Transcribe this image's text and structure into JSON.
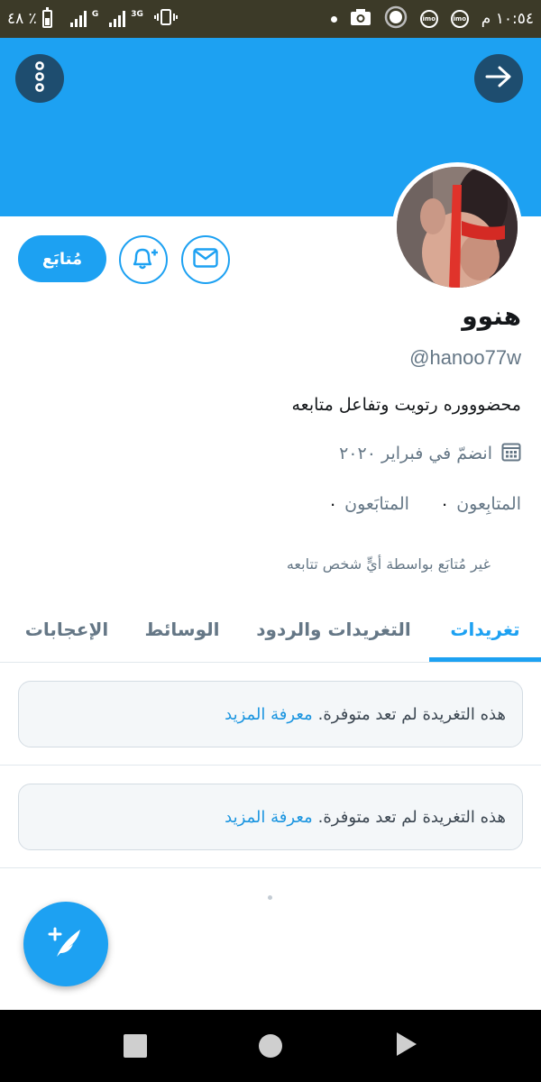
{
  "status_bar": {
    "battery": "٤٨ ٪",
    "network_g": "G",
    "network_3g": "3G",
    "imo1": "imo",
    "imo2": "imo",
    "time": "١٠:٥٤ م"
  },
  "header": {
    "back_icon": "arrow-right-icon",
    "menu_icon": "more-vertical-icon",
    "banner_color": "#1da1f2"
  },
  "actions": {
    "follow_label": "مُتابَع",
    "notify_icon": "bell-plus-icon",
    "message_icon": "envelope-icon"
  },
  "profile": {
    "display_name": "هنوو",
    "handle": "@hanoo77w",
    "bio": "محضوووره رتويت وتفاعل متابعه",
    "joined": "انضمّ في فبراير ٢٠٢٠",
    "following_count": "٠",
    "following_label": "المتابَعون",
    "followers_count": "٠",
    "followers_label": "المتابِعون",
    "not_followed_text": "غير مُتابَع بواسطة أيٍّ شخص تتابعه"
  },
  "tabs": [
    {
      "label": "تغريدات",
      "active": true
    },
    {
      "label": "التغريدات والردود",
      "active": false
    },
    {
      "label": "الوسائط",
      "active": false
    },
    {
      "label": "الإعجابات",
      "active": false
    }
  ],
  "tweets": [
    {
      "text": "هذه التغريدة لم تعد متوفرة.",
      "link": "معرفة المزيد"
    },
    {
      "text": "هذه التغريدة لم تعد متوفرة.",
      "link": "معرفة المزيد"
    }
  ],
  "fab": {
    "icon": "compose-tweet-icon"
  },
  "navbar": {
    "icons": [
      "recents-square-icon",
      "home-circle-icon",
      "back-triangle-icon"
    ]
  },
  "colors": {
    "accent": "#1da1f2",
    "muted": "#657786"
  }
}
